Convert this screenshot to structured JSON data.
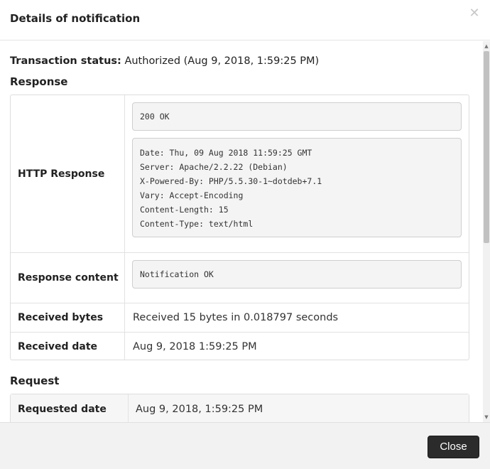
{
  "modal": {
    "title": "Details of notification",
    "close_icon": "close-x-icon"
  },
  "transaction": {
    "status_label": "Transaction status:",
    "status_value": "Authorized (Aug 9, 2018, 1:59:25 PM)"
  },
  "response": {
    "heading": "Response",
    "http_response_label": "HTTP Response",
    "status_code": "200 OK",
    "headers": [
      "Date: Thu, 09 Aug 2018 11:59:25 GMT",
      "Server: Apache/2.2.22 (Debian)",
      "X-Powered-By: PHP/5.5.30-1~dotdeb+7.1",
      "Vary: Accept-Encoding",
      "Content-Length: 15",
      "Content-Type: text/html"
    ],
    "content_label": "Response content",
    "content_value": "Notification OK",
    "received_bytes_label": "Received bytes",
    "received_bytes_value": "Received 15 bytes in 0.018797 seconds",
    "received_date_label": "Received date",
    "received_date_value": "Aug 9, 2018 1:59:25 PM"
  },
  "request": {
    "heading": "Request",
    "requested_date_label": "Requested date",
    "requested_date_value": "Aug 9, 2018, 1:59:25 PM"
  },
  "footer": {
    "close_label": "Close"
  }
}
